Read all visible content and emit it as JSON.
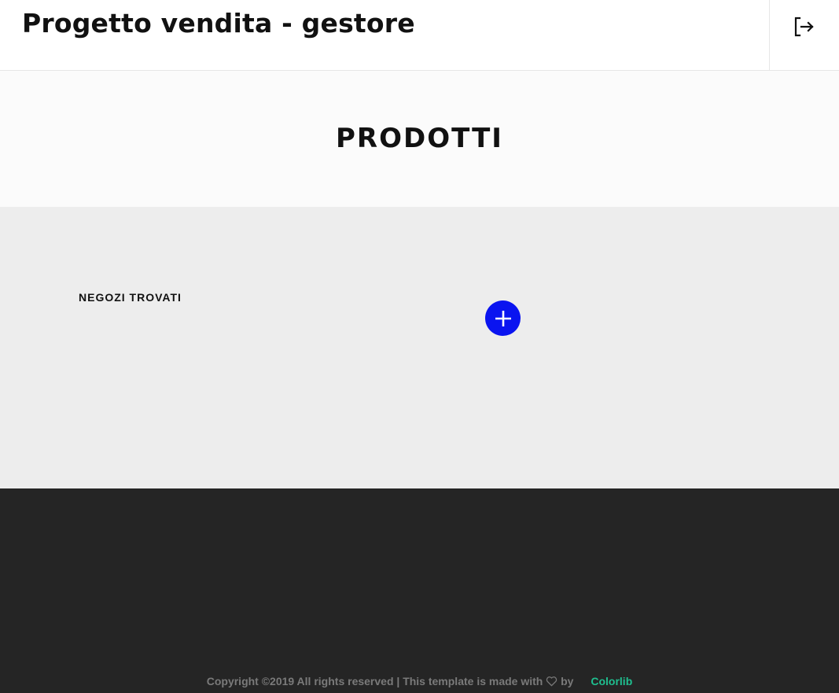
{
  "header": {
    "title": "Progetto vendita - gestore",
    "logout_icon": "logout-icon"
  },
  "hero": {
    "title": "PRODOTTI"
  },
  "main": {
    "section_label": "NEGOZI TROVATI",
    "add_icon": "plus-icon",
    "add_button_color": "#0a14f0"
  },
  "footer": {
    "copyright_prefix": "Copyright ©2019 All rights reserved | This template is made with",
    "copyright_by": "by",
    "brand": "Colorlib",
    "brand_color": "#1fbf8f",
    "heart_icon": "heart-icon"
  }
}
